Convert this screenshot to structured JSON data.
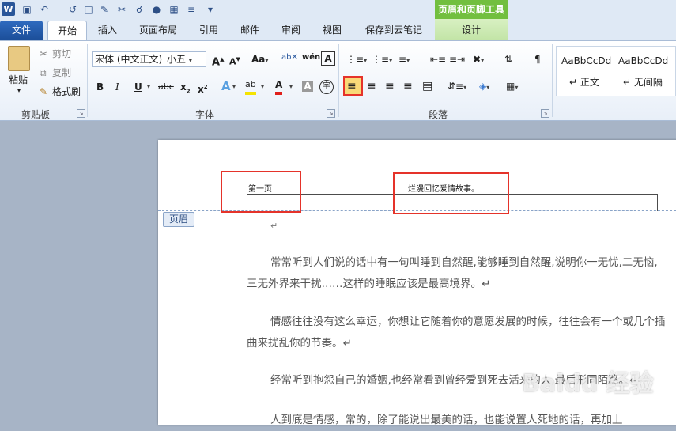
{
  "qat": {
    "logo": "W"
  },
  "context": {
    "header_tools": "页眉和页脚工具",
    "design_tab": "设计"
  },
  "tabs": [
    "文件",
    "开始",
    "插入",
    "页面布局",
    "引用",
    "邮件",
    "审阅",
    "视图",
    "保存到云笔记"
  ],
  "clipboard": {
    "paste": "粘贴",
    "cut": "剪切",
    "copy": "复制",
    "format_painter": "格式刷",
    "group": "剪贴板"
  },
  "font": {
    "name": "宋体 (中文正文)",
    "size": "小五",
    "group": "字体"
  },
  "paragraph": {
    "group": "段落"
  },
  "styles": {
    "preview1": "AaBbCcDd",
    "label1": "↵ 正文",
    "preview2": "AaBbCcDd",
    "label2": "↵ 无间隔"
  },
  "header": {
    "left_text": "第一页",
    "center_text": "烂漫回忆爱情故事。",
    "tag": "页眉"
  },
  "body": {
    "para1": "常常听到人们说的话中有一句叫睡到自然醒,能够睡到自然醒,说明你一无忧,二无恼,三无外界来干扰……这样的睡眠应该是最高境界。↵",
    "para2": "情感往往没有这么幸运，你想让它随着你的意愿发展的时候，往往会有一个或几个插曲来扰乱你的节奏。↵",
    "para3": "经常听到抱怨自己的婚姻,也经常看到曾经爱到死去活来的人,最后形同陌路。↵",
    "para4": "人到底是情感，常的，除了能说出最美的话，也能说置人死地的话，再加上"
  },
  "watermark": "Baidu 经验"
}
